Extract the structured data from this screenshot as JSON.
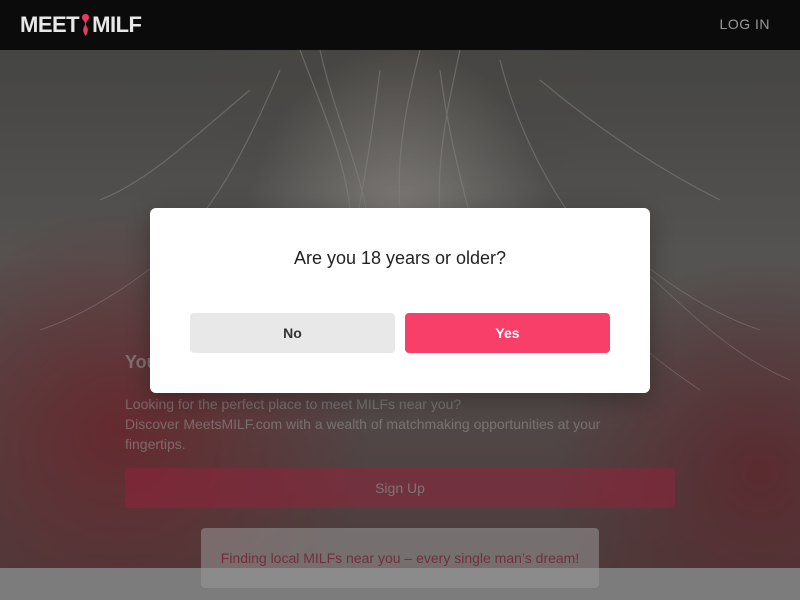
{
  "header": {
    "logo_left": "MEET",
    "logo_right": "MILF",
    "login_label": "LOG IN"
  },
  "main": {
    "headline": "You",
    "description_line1": "Looking for the perfect place to meet MILFs near you?",
    "description_line2": "Discover MeetsMILF.com with a wealth of matchmaking opportunities at your fingertips.",
    "signup_label": "Sign Up",
    "tagline": "Finding local MILFs near you – every single man’s dream!"
  },
  "modal": {
    "question": "Are you 18 years or older?",
    "no_label": "No",
    "yes_label": "Yes"
  },
  "colors": {
    "accent": "#f73f6a",
    "header_bg": "#0b0b0b",
    "no_button_bg": "#e8e8e8"
  }
}
